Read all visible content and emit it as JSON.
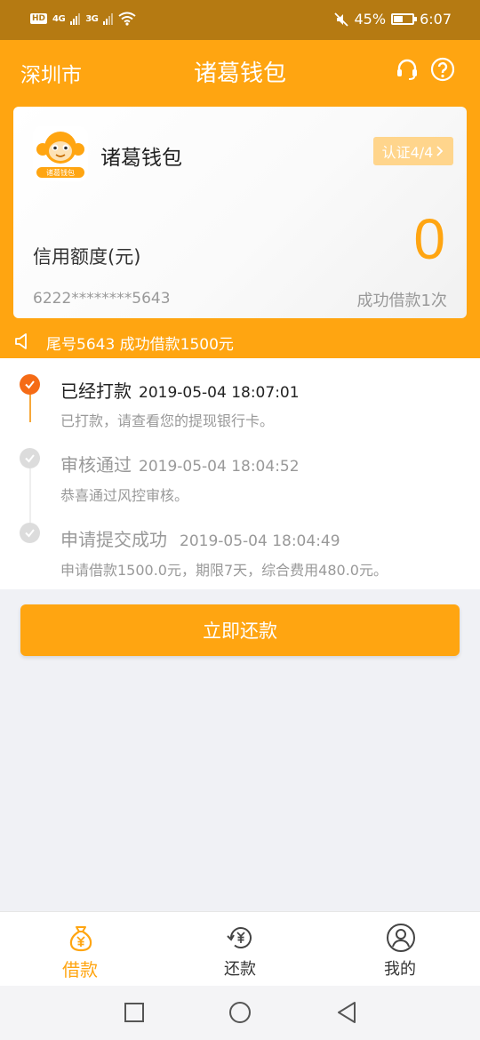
{
  "status_bar": {
    "network_left": "4G",
    "network_right": "3G",
    "battery": "45%",
    "time": "6:07",
    "hd_label": "HD"
  },
  "header": {
    "city": "深圳市",
    "title": "诸葛钱包",
    "icons": [
      "headset-icon",
      "help-icon"
    ]
  },
  "card": {
    "logo_text": "诸葛钱包",
    "name": "诸葛钱包",
    "cert_badge": "认证4/4",
    "limit_label": "信用额度(元)",
    "limit_value": "0",
    "card_number": "6222********5643",
    "success_count": "成功借款1次"
  },
  "notice": {
    "text": "尾号5643 成功借款1500元"
  },
  "timeline": [
    {
      "title": "已经打款",
      "time": "2019-05-04 18:07:01",
      "desc": "已打款，请查看您的提现银行卡。",
      "state": "active"
    },
    {
      "title": "审核通过",
      "time": "2019-05-04 18:04:52",
      "desc": "恭喜通过风控审核。",
      "state": "done"
    },
    {
      "title": "申请提交成功",
      "time": "2019-05-04 18:04:49",
      "desc": "申请借款1500.0元，期限7天，综合费用480.0元。",
      "state": "done"
    }
  ],
  "repay_button": "立即还款",
  "tabs": [
    {
      "label": "借款",
      "icon": "money-bag-icon",
      "active": true
    },
    {
      "label": "还款",
      "icon": "repay-icon",
      "active": false
    },
    {
      "label": "我的",
      "icon": "user-icon",
      "active": false
    }
  ],
  "colors": {
    "primary": "#ffa511",
    "status_bar": "#b57a12",
    "active_dot": "#f56b16",
    "badge": "#ffd58c"
  }
}
